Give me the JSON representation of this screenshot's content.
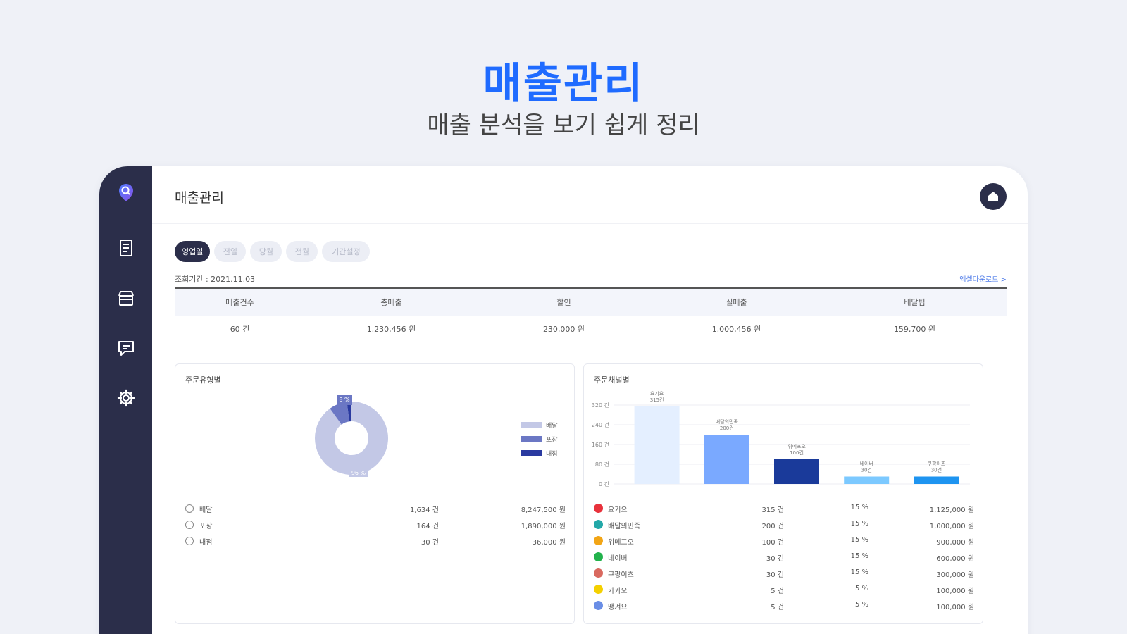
{
  "hero": {
    "title": "매출관리",
    "subtitle": "매출 분석을 보기 쉽게 정리"
  },
  "sidebar": {
    "items": [
      {
        "icon": "location-logo-icon"
      },
      {
        "icon": "receipt-icon"
      },
      {
        "icon": "store-icon"
      },
      {
        "icon": "chat-icon"
      },
      {
        "icon": "gear-icon"
      }
    ]
  },
  "header": {
    "title": "매출관리",
    "home_icon": "home-icon"
  },
  "tabs": [
    "영업일",
    "전일",
    "당월",
    "전월",
    "기간설정"
  ],
  "period_label": "조회기간 : 2021.11.03",
  "export_link": "엑셀다운로드 >",
  "summary": {
    "headers": [
      "매출건수",
      "총매출",
      "할인",
      "실매출",
      "배달팁"
    ],
    "values": [
      "60 건",
      "1,230,456 원",
      "230,000 원",
      "1,000,456 원",
      "159,700 원"
    ]
  },
  "type_panel": {
    "title": "주문유형별",
    "legend": [
      "배달",
      "포장",
      "내점"
    ],
    "rows": [
      {
        "label": "배달",
        "count": "1,634 건",
        "amount": "8,247,500 원"
      },
      {
        "label": "포장",
        "count": "164 건",
        "amount": "1,890,000 원"
      },
      {
        "label": "내점",
        "count": "30 건",
        "amount": "36,000 원"
      }
    ]
  },
  "channel_panel": {
    "title": "주문채널별",
    "rows": [
      {
        "label": "요기요",
        "count": "315 건",
        "pct": "15 %",
        "amount": "1,125,000 원",
        "color": "#e8323c"
      },
      {
        "label": "배달의민족",
        "count": "200 건",
        "pct": "15 %",
        "amount": "1,000,000 원",
        "color": "#23a8a8"
      },
      {
        "label": "위메프오",
        "count": "100 건",
        "pct": "15 %",
        "amount": "900,000 원",
        "color": "#f2a516"
      },
      {
        "label": "네이버",
        "count": "30 건",
        "pct": "15 %",
        "amount": "600,000 원",
        "color": "#22b24c"
      },
      {
        "label": "쿠팡이츠",
        "count": "30 건",
        "pct": "15 %",
        "amount": "300,000 원",
        "color": "#d9695f"
      },
      {
        "label": "카카오",
        "count": "5 건",
        "pct": "5 %",
        "amount": "100,000 원",
        "color": "#f4d000"
      },
      {
        "label": "땡겨요",
        "count": "5 건",
        "pct": "5 %",
        "amount": "100,000 원",
        "color": "#6a8ee6"
      }
    ]
  },
  "chart_data": [
    {
      "type": "pie",
      "title": "주문유형별",
      "categories": [
        "배달",
        "포장",
        "내점"
      ],
      "values": [
        90,
        8,
        2
      ],
      "data_labels": [
        "96 %",
        "8 %"
      ],
      "colors": [
        "#c3c8e6",
        "#6b77c4",
        "#2a3aa0"
      ]
    },
    {
      "type": "bar",
      "title": "주문채널별",
      "categories": [
        "요기요",
        "배달의민족",
        "위메프오",
        "네이버",
        "쿠팡이츠"
      ],
      "values": [
        315,
        200,
        100,
        30,
        30
      ],
      "ylim": [
        0,
        320
      ],
      "yticks": [
        0,
        80,
        160,
        240,
        320
      ],
      "ytick_labels": [
        "0 건",
        "80 건",
        "160 건",
        "240 건",
        "320 건"
      ],
      "data_labels": [
        "요기요\n315건",
        "배달의민족\n200건",
        "위메프오\n100건",
        "네이버\n30건",
        "쿠팡이츠\n30건"
      ],
      "colors": [
        "#e4efff",
        "#7aa9ff",
        "#1a3a9a",
        "#7cc9ff",
        "#1e94f0"
      ],
      "grid": true
    }
  ]
}
